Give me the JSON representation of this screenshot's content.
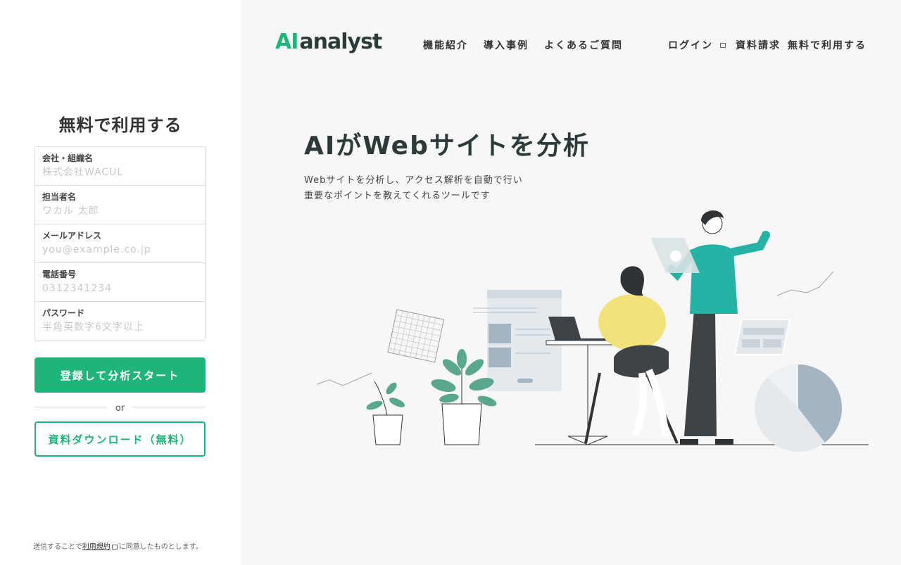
{
  "form": {
    "title": "無料で利用する",
    "fields": [
      {
        "label": "会社・組織名",
        "placeholder": "株式会社WACUL"
      },
      {
        "label": "担当者名",
        "placeholder": "ワカル 太郎"
      },
      {
        "label": "メールアドレス",
        "placeholder": "you@example.co.jp"
      },
      {
        "label": "電話番号",
        "placeholder": "0312341234"
      },
      {
        "label": "パスワード",
        "placeholder": "半角英数字6文字以上"
      }
    ],
    "start_button": "登録して分析スタート",
    "or": "or",
    "download_button": "資料ダウンロード（無料）",
    "terms_prefix": "送信することで",
    "terms_link": "利用規約",
    "terms_suffix": "に同意したものとします。"
  },
  "header": {
    "logo_ai": "AI",
    "logo_name": "analyst",
    "nav": [
      "機能紹介",
      "導入事例",
      "よくあるご質問"
    ],
    "login": "ログイン",
    "request": "資料請求",
    "free": "無料で利用する"
  },
  "hero": {
    "title": "AIがWebサイトを分析",
    "sub_line1": "Webサイトを分析し、アクセス解析を自動で行い",
    "sub_line2": "重要なポイントを教えてくれるツールです"
  },
  "colors": {
    "brand_green": "#1fb57a",
    "teal": "#26b3a6",
    "yellow": "#f2e27a",
    "dark": "#3d4347",
    "slate": "#a3b4c2"
  }
}
